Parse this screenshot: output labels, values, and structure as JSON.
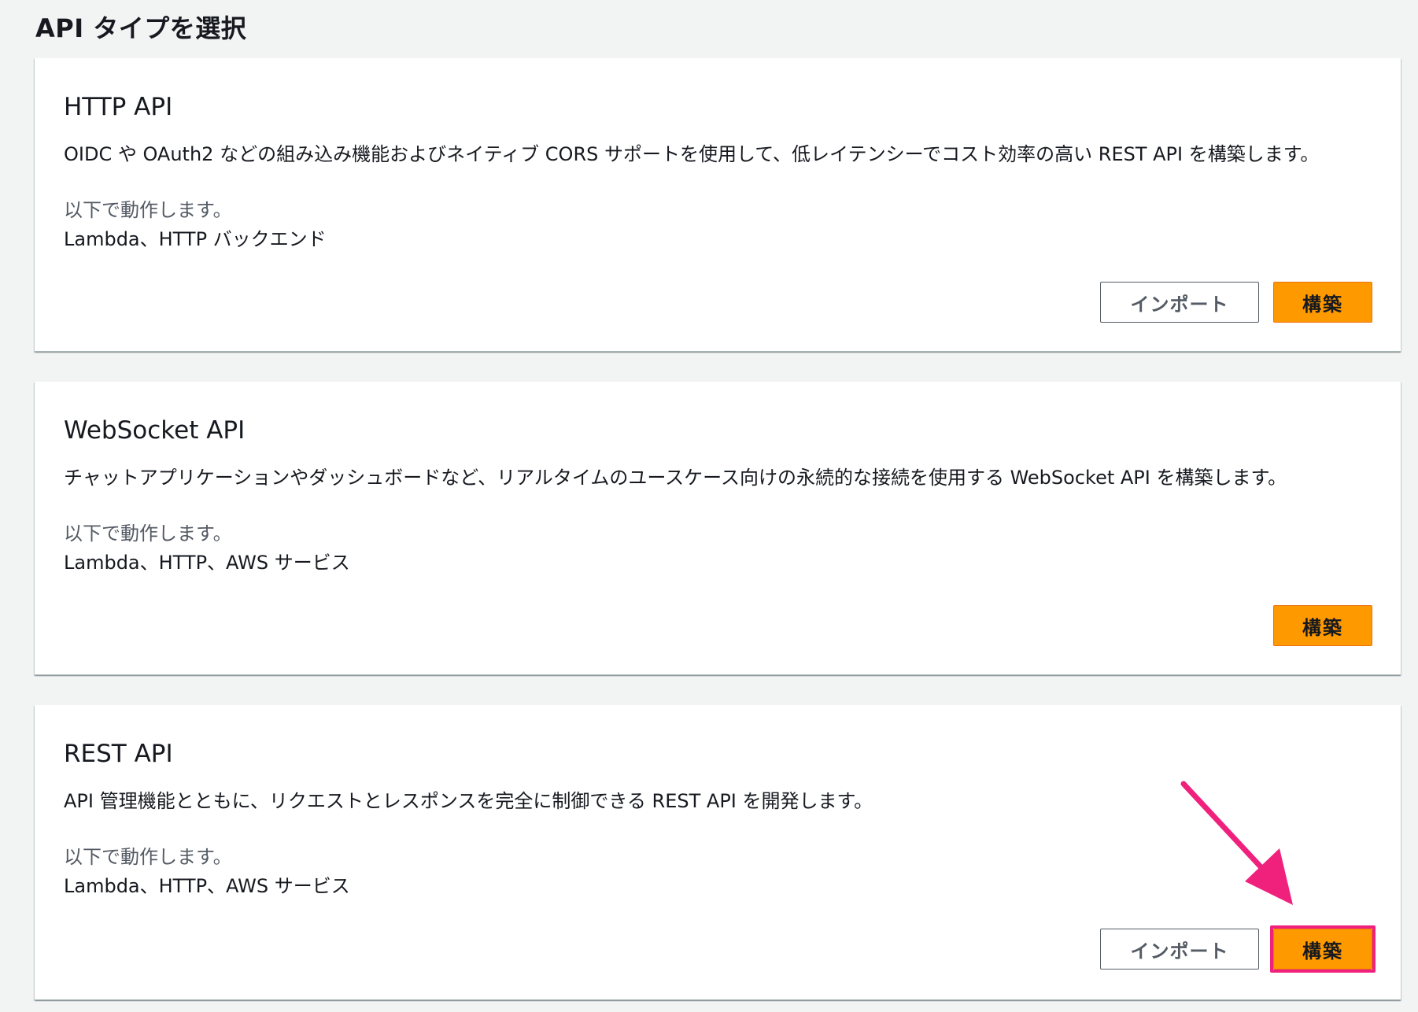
{
  "page": {
    "title": "API タイプを選択"
  },
  "cards": [
    {
      "title": "HTTP API",
      "description": "OIDC や OAuth2 などの組み込み機能およびネイティブ CORS サポートを使用して、低レイテンシーでコスト効率の高い REST API を構築します。",
      "works_with_label": "以下で動作します。",
      "works_with_value": "Lambda、HTTP バックエンド",
      "import_label": "インポート",
      "build_label": "構築"
    },
    {
      "title": "WebSocket API",
      "description": "チャットアプリケーションやダッシュボードなど、リアルタイムのユースケース向けの永続的な接続を使用する WebSocket API を構築します。",
      "works_with_label": "以下で動作します。",
      "works_with_value": "Lambda、HTTP、AWS サービス",
      "build_label": "構築"
    },
    {
      "title": "REST API",
      "description": "API 管理機能とともに、リクエストとレスポンスを完全に制御できる REST API を開発します。",
      "works_with_label": "以下で動作します。",
      "works_with_value": "Lambda、HTTP、AWS サービス",
      "import_label": "インポート",
      "build_label": "構築"
    }
  ],
  "annotation": {
    "color": "#f0217d",
    "icon": "pointer-arrow-icon"
  },
  "colors": {
    "primary_button": "#ff9900",
    "background": "#f2f3f3"
  }
}
